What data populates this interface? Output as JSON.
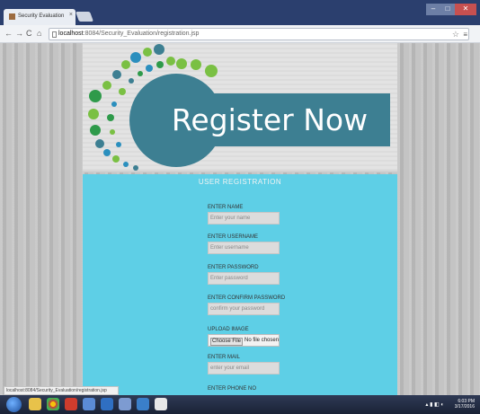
{
  "browser": {
    "tab_title": "Security Evaluation",
    "tab_close": "×",
    "url_host": "localhost",
    "url_path": ":8084/Security_Evaluation/registration.jsp",
    "status_url": "localhost:8084/Security_Evaluation/registration.jsp",
    "controls": {
      "minimize": "–",
      "maximize": "□",
      "close": "✕"
    }
  },
  "banner": {
    "heading": "Register Now",
    "colors": {
      "teal": "#3d7f92",
      "green": "#7ac043",
      "blue": "#2b8fbe"
    }
  },
  "form": {
    "title": "USER REGISTRATION",
    "fields": [
      {
        "label": "ENTER NAME",
        "placeholder": "Enter your name"
      },
      {
        "label": "ENTER USERNAME",
        "placeholder": "Enter username"
      },
      {
        "label": "ENTER PASSWORD",
        "placeholder": "Enter password"
      },
      {
        "label": "ENTER CONFIRM PASSWORD",
        "placeholder": "confirm your password"
      },
      {
        "label": "UPLOAD IMAGE",
        "file_button": "Choose File",
        "file_status": "No file chosen"
      },
      {
        "label": "ENTER MAIL",
        "placeholder": "enter your email"
      },
      {
        "label": "ENTER PHONE NO"
      }
    ],
    "background": "#5ecfe6"
  },
  "taskbar": {
    "time": "6:03 PM",
    "date": "3/17/2016"
  }
}
